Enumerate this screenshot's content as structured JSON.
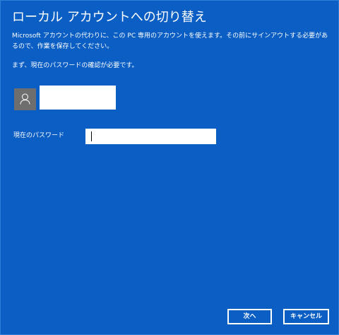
{
  "dialog": {
    "title": "ローカル アカウントへの切り替え",
    "description": "Microsoft アカウントの代わりに、この PC 専用のアカウントを使えます。その前にサインアウトする必要があるので、作業を保存してください。",
    "must_verify": "まず、現在のパスワードの確認が必要です。"
  },
  "user": {
    "avatar_icon": "user-icon",
    "name": ""
  },
  "password": {
    "label": "現在のパスワード",
    "value": ""
  },
  "buttons": {
    "next": "次へ",
    "cancel": "キャンセル"
  },
  "colors": {
    "background": "#0a5ec4",
    "avatar_bg": "#6e6e6e",
    "text": "#ffffff"
  }
}
